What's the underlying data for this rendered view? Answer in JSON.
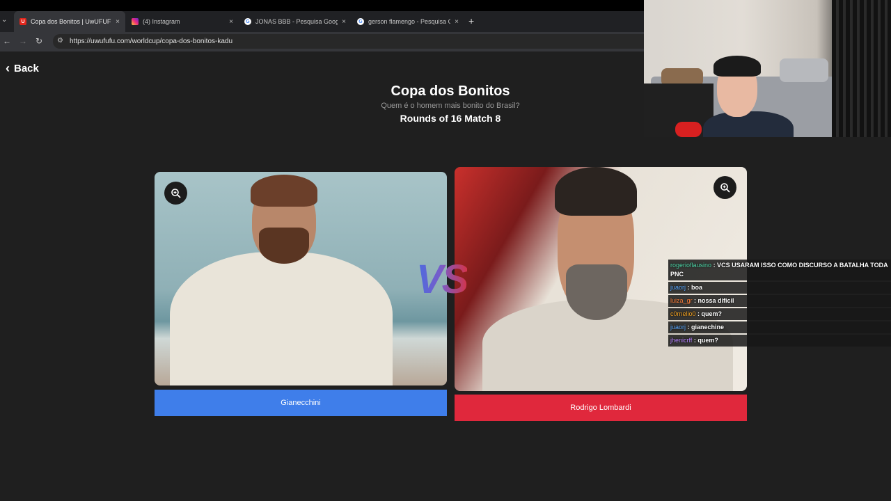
{
  "browser": {
    "tabs": [
      {
        "title": "Copa dos Bonitos | UwUFUFU",
        "favicon": "U",
        "favicon_color": "#e2261c",
        "active": true
      },
      {
        "title": "(4) Instagram",
        "favicon": "",
        "favicon_color": "#d62976",
        "active": false
      },
      {
        "title": "JONAS BBB - Pesquisa Google",
        "favicon": "G",
        "favicon_color": "#4285f4",
        "active": false
      },
      {
        "title": "gerson flamengo - Pesquisa Go",
        "favicon": "G",
        "favicon_color": "#4285f4",
        "active": false
      }
    ],
    "new_tab": "+",
    "close_glyph": "×",
    "url": "https://uwufufu.com/worldcup/copa-dos-bonitos-kadu"
  },
  "page": {
    "back_label": "Back",
    "title": "Copa dos Bonitos",
    "subtitle": "Quem é o homem mais bonito do Brasil?",
    "round": "Rounds of 16 Match 8",
    "vs": "VS",
    "left_choice": {
      "name": "Gianecchini",
      "color": "#3f7eea"
    },
    "right_choice": {
      "name": "Rodrigo Lombardi",
      "color": "#e0283c"
    }
  },
  "chat": [
    {
      "user": "rogerioflausino",
      "user_color": "#4fd6a8",
      "message": ": VCS USARAM ISSO COMO DISCURSO A BATALHA TODA PNC"
    },
    {
      "user": "juaorj",
      "user_color": "#5aa8ff",
      "message": ": boa"
    },
    {
      "user": "luiza_gr",
      "user_color": "#ff7f3a",
      "message": ": nossa dificil"
    },
    {
      "user": "c0rnelio0",
      "user_color": "#f0a020",
      "message": ": quem?"
    },
    {
      "user": "juaorj",
      "user_color": "#5aa8ff",
      "message": ": gianechine"
    },
    {
      "user": "jhenicrff",
      "user_color": "#b784ff",
      "message": ": quem?"
    }
  ]
}
